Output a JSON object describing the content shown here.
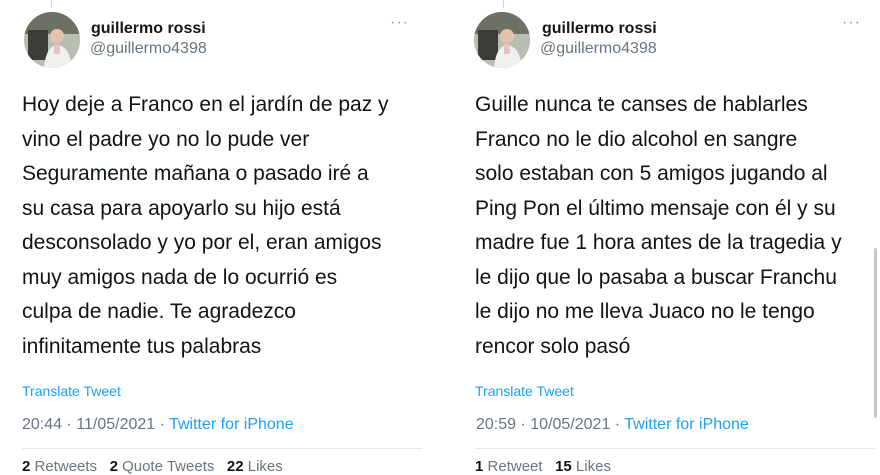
{
  "tweets": [
    {
      "author_name": "guillermo rossi",
      "author_handle": "@guillermo4398",
      "more_icon": "···",
      "lines": [
        "Hoy deje a Franco en el jardín de paz y",
        "vino el padre yo no lo pude ver",
        "Seguramente mañana o pasado iré a",
        "su casa para apoyarlo su hijo está",
        "desconsolado y yo por el, eran amigos",
        "muy amigos nada de lo ocurrió es",
        "culpa de nadie.  Te agradezco",
        "infinitamente tus palabras"
      ],
      "translate_label": "Translate Tweet",
      "time": "20:44",
      "date": "11/05/2021",
      "separator": " · ",
      "source": "Twitter for iPhone",
      "stats": [
        {
          "count": "2",
          "label": "Retweets"
        },
        {
          "count": "2",
          "label": "Quote Tweets"
        },
        {
          "count": "22",
          "label": "Likes"
        }
      ]
    },
    {
      "author_name": "guillermo rossi",
      "author_handle": "@guillermo4398",
      "more_icon": "···",
      "lines": [
        "Guille nunca te canses de hablarles",
        "Franco no le dio alcohol en sangre",
        "solo estaban con 5 amigos jugando al",
        "Ping Pon el último mensaje con él y su",
        "madre fue 1 hora antes de la tragedia y",
        "le dijo que lo pasaba a buscar Franchu",
        "le dijo no me lleva Juaco no le tengo",
        "rencor solo pasó"
      ],
      "translate_label": "Translate Tweet",
      "time": "20:59",
      "date": "10/05/2021",
      "separator": " · ",
      "source": "Twitter for iPhone",
      "stats": [
        {
          "count": "1",
          "label": "Retweet"
        },
        {
          "count": "15",
          "label": "Likes"
        }
      ]
    }
  ],
  "colors": {
    "link": "#1da1f2",
    "secondary_text": "#657786",
    "primary_text": "#0f1419"
  }
}
